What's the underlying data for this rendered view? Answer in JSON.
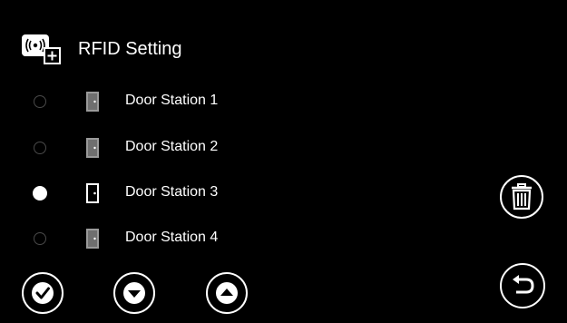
{
  "header": {
    "title": "RFID Setting",
    "icon": "rfid-add-icon"
  },
  "stations": [
    {
      "label": "Door Station 1",
      "selected": false
    },
    {
      "label": "Door Station 2",
      "selected": false
    },
    {
      "label": "Door Station 3",
      "selected": true
    },
    {
      "label": "Door Station 4",
      "selected": false
    }
  ],
  "buttons": {
    "confirm": "checkmark-icon",
    "down": "arrow-down-icon",
    "up": "arrow-up-icon",
    "delete": "trash-icon",
    "back": "back-arrow-icon"
  },
  "colors": {
    "background": "#000000",
    "foreground": "#ffffff",
    "door_inactive": "#9a9a9a",
    "radio_inactive": "#4a4a4a"
  }
}
